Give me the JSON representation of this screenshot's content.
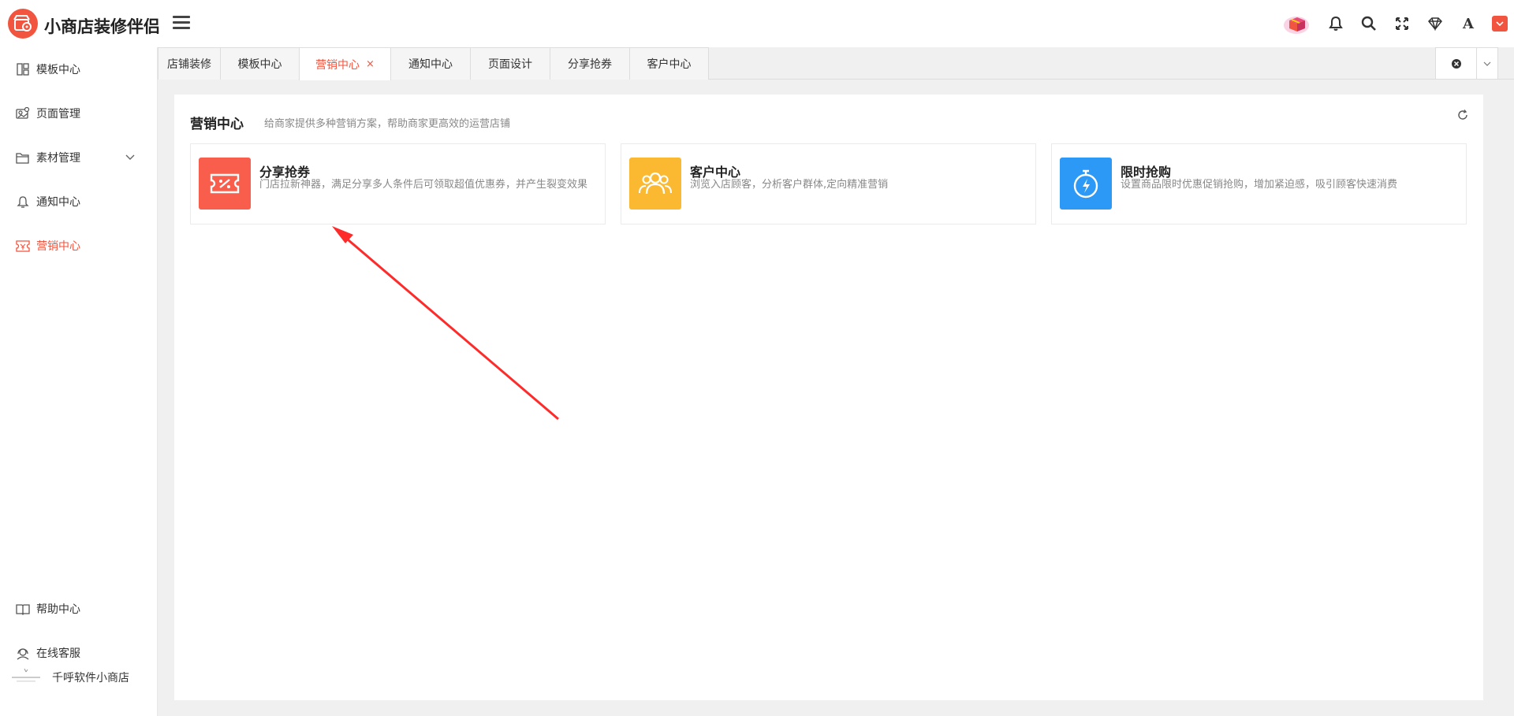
{
  "header": {
    "app_title": "小商店装修伴侣",
    "icons": [
      "gift-box-icon",
      "bell-icon",
      "search-icon",
      "fullscreen-icon",
      "diamond-icon",
      "font-icon",
      "user-dropdown-icon"
    ],
    "font_letter": "A"
  },
  "sidebar": {
    "items": [
      {
        "label": "模板中心",
        "icon": "template-icon"
      },
      {
        "label": "页面管理",
        "icon": "page-icon"
      },
      {
        "label": "素材管理",
        "icon": "folder-icon"
      },
      {
        "label": "通知中心",
        "icon": "bell-icon"
      },
      {
        "label": "营销中心",
        "icon": "coupon-icon",
        "active": true
      }
    ],
    "bottom_items": [
      {
        "label": "帮助中心",
        "icon": "book-icon"
      },
      {
        "label": "在线客服",
        "icon": "headset-icon"
      }
    ],
    "company": "千呼软件小商店"
  },
  "tabs": [
    {
      "label": "店铺装修"
    },
    {
      "label": "模板中心"
    },
    {
      "label": "营销中心",
      "active": true,
      "closable": "×"
    },
    {
      "label": "通知中心"
    },
    {
      "label": "页面设计"
    },
    {
      "label": "分享抢券"
    },
    {
      "label": "客户中心"
    }
  ],
  "panel": {
    "title": "营销中心",
    "description": "给商家提供多种营销方案，帮助商家更高效的运营店铺"
  },
  "cards": [
    {
      "title": "分享抢券",
      "desc": "门店拉新神器，满足分享多人条件后可领取超值优惠券，并产生裂变效果",
      "color": "#f95d4c",
      "icon": "coupon-icon"
    },
    {
      "title": "客户中心",
      "desc": "浏览入店顾客，分析客户群体,定向精准营销",
      "color": "#fbb931",
      "icon": "users-icon"
    },
    {
      "title": "限时抢购",
      "desc": "设置商品限时优惠促销抢购，增加紧迫感，吸引顾客快速消费",
      "color": "#2b99f5",
      "icon": "stopwatch-icon"
    }
  ],
  "colors": {
    "accent": "#f2553f",
    "annotation_arrow": "#ff2a2a"
  }
}
